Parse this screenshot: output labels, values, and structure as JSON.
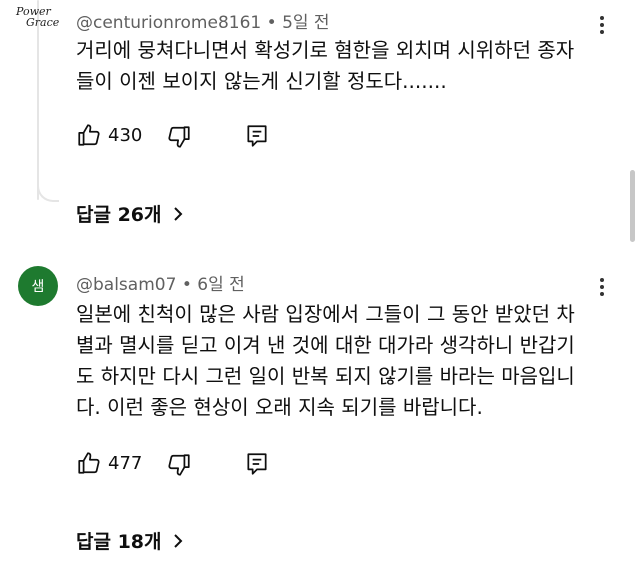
{
  "comments": [
    {
      "avatar_text": [
        "Power",
        "Grace"
      ],
      "handle": "@centurionrome8161",
      "separator": "•",
      "time": "5일 전",
      "lines": [
        "거리에 뭉쳐다니면서 확성기로 혐한을 외치며 시위하던 종자",
        "들이 이젠 보이지 않는게 신기할 정도다......."
      ],
      "likes": "430",
      "replies_label": "답글 26개"
    },
    {
      "avatar_text": "샘",
      "avatar_color": "#1e7a2f",
      "handle": "@balsam07",
      "separator": "•",
      "time": "6일 전",
      "lines": [
        "일본에 친척이 많은 사람 입장에서 그들이 그 동안 받았던 차",
        "별과 멸시를 딛고 이겨 낸 것에 대한 대가라 생각하니 반갑기",
        "도 하지만 다시 그런 일이 반복 되지 않기를 바라는 마음입니",
        "다. 이런 좋은 현상이 오래 지속 되기를 바랍니다."
      ],
      "likes": "477",
      "replies_label": "답글 18개"
    }
  ],
  "icons": [
    "thumbs-up-icon",
    "thumbs-down-icon",
    "reply-icon",
    "more-vert-icon",
    "chevron-right-icon"
  ]
}
